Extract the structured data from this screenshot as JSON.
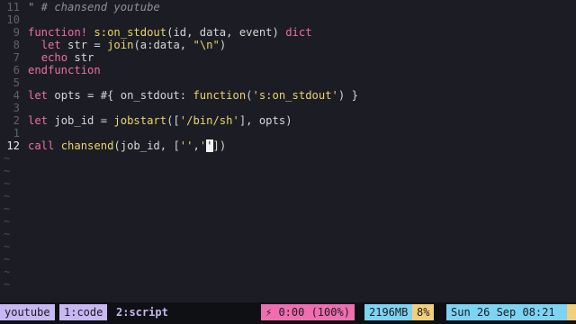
{
  "editor": {
    "lines": [
      {
        "num": "11",
        "parts": [
          [
            "cm",
            "\" # chansend youtube"
          ]
        ]
      },
      {
        "num": "10",
        "parts": []
      },
      {
        "num": "9",
        "parts": [
          [
            "kw",
            "function!"
          ],
          [
            "tx",
            " "
          ],
          [
            "fn",
            "s:on_stdout"
          ],
          [
            "tx",
            "(id, data, event) "
          ],
          [
            "kw",
            "dict"
          ]
        ]
      },
      {
        "num": "8",
        "parts": [
          [
            "tx",
            "  "
          ],
          [
            "kw",
            "let"
          ],
          [
            "tx",
            " str = "
          ],
          [
            "fn",
            "join"
          ],
          [
            "tx",
            "(a:data, "
          ],
          [
            "str",
            "\"\\n\""
          ],
          [
            "tx",
            ")"
          ]
        ]
      },
      {
        "num": "7",
        "parts": [
          [
            "tx",
            "  "
          ],
          [
            "kw",
            "echo"
          ],
          [
            "tx",
            " str"
          ]
        ]
      },
      {
        "num": "6",
        "parts": [
          [
            "kw",
            "endfunction"
          ]
        ]
      },
      {
        "num": "5",
        "parts": []
      },
      {
        "num": "4",
        "parts": [
          [
            "kw",
            "let"
          ],
          [
            "tx",
            " opts = #{ on_stdout: "
          ],
          [
            "fn",
            "function"
          ],
          [
            "tx",
            "("
          ],
          [
            "str",
            "'s:on_stdout'"
          ],
          [
            "tx",
            ") }"
          ]
        ]
      },
      {
        "num": "3",
        "parts": []
      },
      {
        "num": "2",
        "parts": [
          [
            "kw",
            "let"
          ],
          [
            "tx",
            " job_id = "
          ],
          [
            "fn",
            "jobstart"
          ],
          [
            "tx",
            "(["
          ],
          [
            "str",
            "'/bin/sh'"
          ],
          [
            "tx",
            "], opts)"
          ]
        ]
      },
      {
        "num": "1",
        "parts": []
      },
      {
        "num": "12",
        "current": true,
        "parts": [
          [
            "kw",
            "call"
          ],
          [
            "tx",
            " "
          ],
          [
            "fn",
            "chansend"
          ],
          [
            "tx",
            "(job_id, ["
          ],
          [
            "str",
            "''"
          ],
          [
            "tx",
            ","
          ],
          [
            "str",
            "'"
          ],
          [
            "cursor",
            "'"
          ],
          [
            "tx",
            "])"
          ]
        ]
      }
    ],
    "tilde_char": "~",
    "tilde_count": 11
  },
  "statusbar": {
    "session": "youtube",
    "window1": "1:code",
    "window2": "2:script",
    "battery": "⚡ 0:00 (100%)",
    "memory": "2196MB",
    "cpu": "8%",
    "clock": "Sun 26 Sep 08:21"
  },
  "colors": {
    "background": "#1c1d24",
    "keyword": "#ec6ea8",
    "function": "#e8d56a",
    "comment": "#8e90a0",
    "status_lavender": "#c7b7f2",
    "status_pink": "#ef6eb0",
    "status_cyan": "#7dd3f2",
    "status_yellow": "#f2cf7a"
  }
}
